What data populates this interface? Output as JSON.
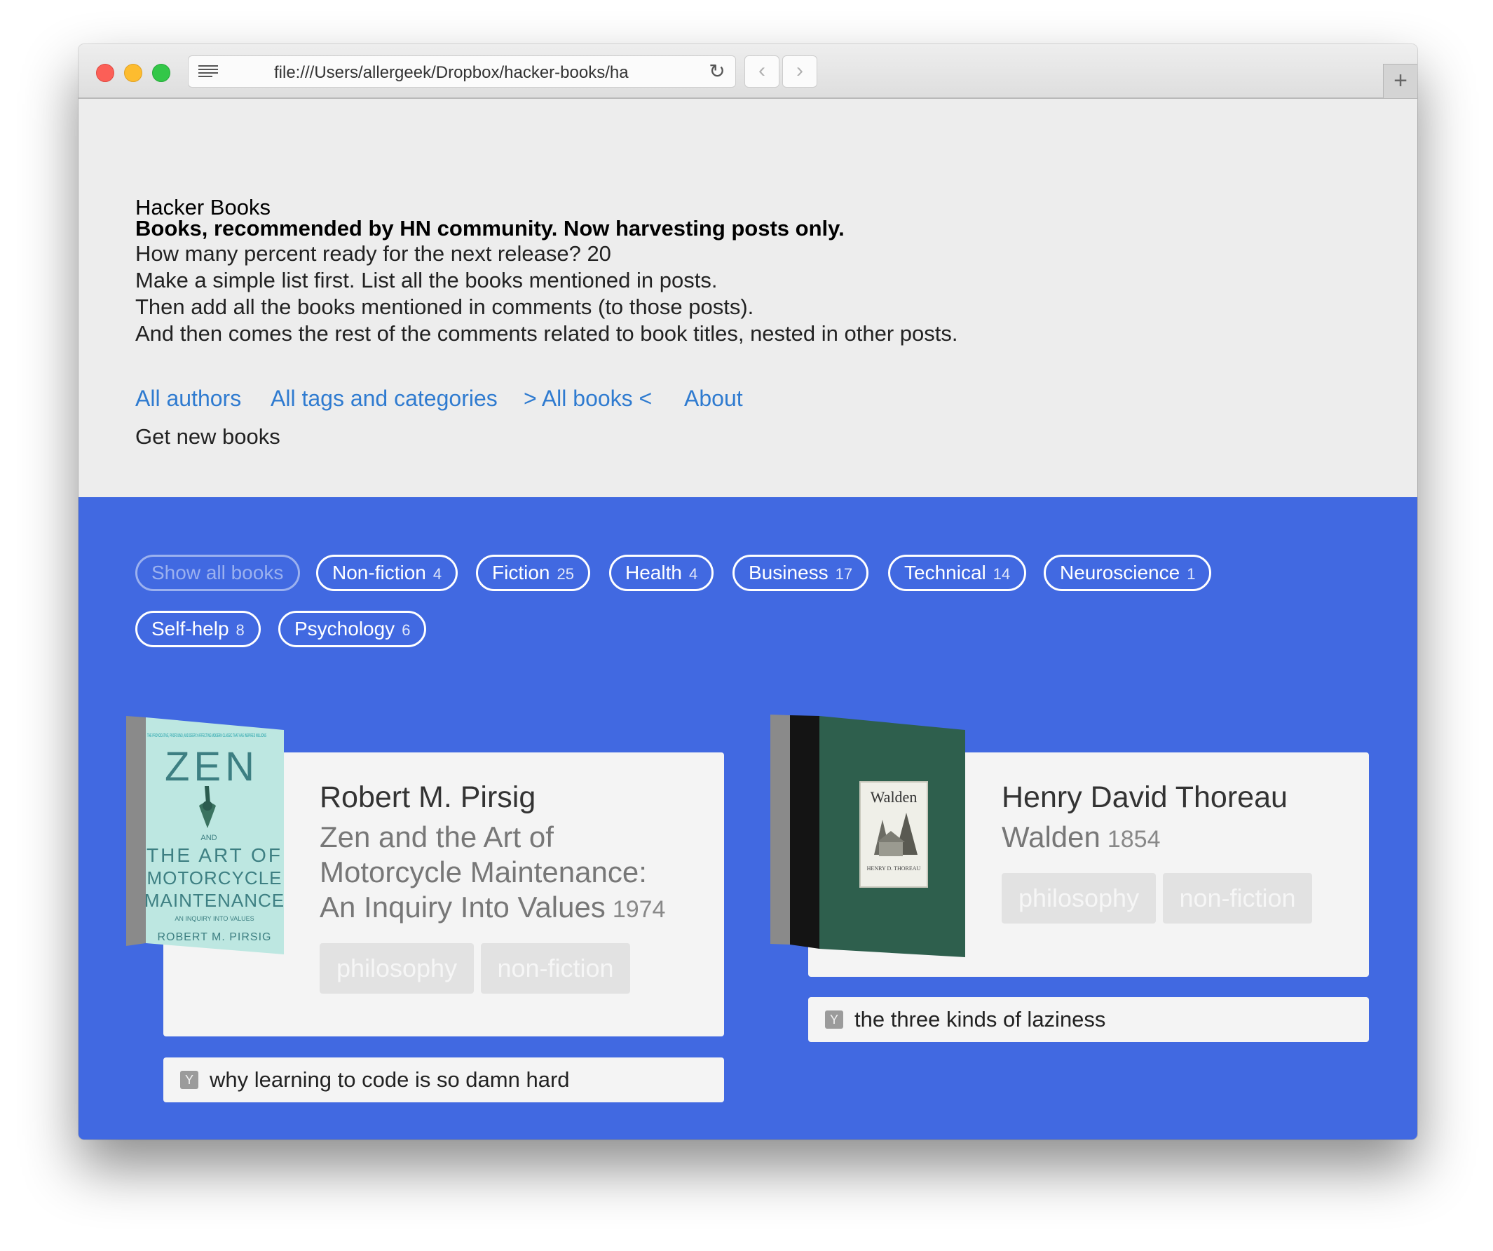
{
  "browser": {
    "url": "file:///Users/allergeek/Dropbox/hacker-books/ha",
    "back_glyph": "‹",
    "forward_glyph": "›",
    "reload_glyph": "↻",
    "newtab_glyph": "+"
  },
  "header": {
    "title": "Hacker Books",
    "subtitle": "Books, recommended by HN community. Now harvesting posts only.",
    "lines": [
      "How many percent ready for the next release? 20",
      "Make a simple list first. List all the books mentioned in posts.",
      "Then add all the books mentioned in comments (to those posts).",
      "And then comes the rest of the comments related to book titles, nested in other posts."
    ],
    "nav": [
      "All authors",
      "All tags and categories",
      "> All books <",
      "About"
    ],
    "get_new": "Get new books"
  },
  "filters": {
    "show_all": "Show all books",
    "tags": [
      {
        "label": "Non-fiction",
        "count": "4"
      },
      {
        "label": "Fiction",
        "count": "25"
      },
      {
        "label": "Health",
        "count": "4"
      },
      {
        "label": "Business",
        "count": "17"
      },
      {
        "label": "Technical",
        "count": "14"
      },
      {
        "label": "Neuroscience",
        "count": "1"
      },
      {
        "label": "Self-help",
        "count": "8"
      },
      {
        "label": "Psychology",
        "count": "6"
      }
    ]
  },
  "books": [
    {
      "author": "Robert M. Pirsig",
      "title_lines": [
        "Zen and the Art of",
        "Motorcycle Maintenance:",
        "An Inquiry Into Values"
      ],
      "year": "1974",
      "genres": [
        "philosophy",
        "non-fiction"
      ],
      "hn_link": "why learning to code is so damn hard",
      "cover_text": {
        "top": "THE PROVOCATIVE, PROFOUND, AND DEEPLY AFFECTING MODERN CLASSIC THAT HAS INSPIRED MILLIONS",
        "zen": "ZEN",
        "and": "AND",
        "art": "THE ART OF",
        "moto": "MOTORCYCLE",
        "maint": "MAINTENANCE",
        "sub": "AN INQUIRY INTO VALUES",
        "author": "ROBERT M. PIRSIG"
      }
    },
    {
      "author": "Henry David Thoreau",
      "title_lines": [
        "Walden"
      ],
      "year": "1854",
      "genres": [
        "philosophy",
        "non-fiction"
      ],
      "hn_link": "the three kinds of laziness",
      "cover_text": {
        "title": "Walden",
        "author": "HENRY D. THOREAU"
      }
    }
  ],
  "colors": {
    "blue_bg": "#4169e1",
    "link": "#2f7bd0",
    "card": "#f4f4f4"
  },
  "icons": {
    "hn": "Y"
  }
}
